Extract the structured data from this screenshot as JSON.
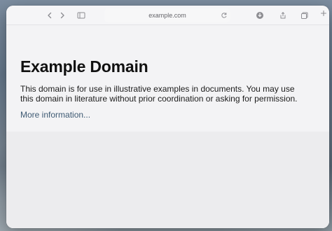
{
  "browser": {
    "address": "example.com"
  },
  "page": {
    "title": "Example Domain",
    "description": "This domain is for use in illustrative examples in documents. You may use this domain in literature without prior coordination or asking for permission.",
    "link_text": "More information..."
  },
  "icons": {
    "back": "chevron-left-icon",
    "forward": "chevron-right-icon",
    "sidebar": "sidebar-icon",
    "reload": "reload-icon",
    "download": "download-icon",
    "share": "share-icon",
    "tabs": "tabs-icon",
    "new_tab": "plus-icon"
  }
}
